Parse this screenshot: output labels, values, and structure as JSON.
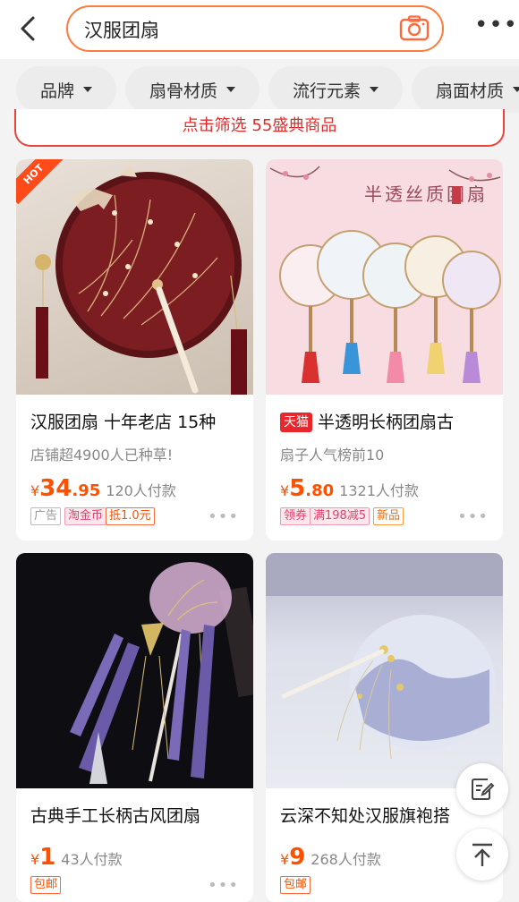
{
  "search": {
    "query": "汉服团扇"
  },
  "filters": [
    {
      "label": "品牌"
    },
    {
      "label": "扇骨材质"
    },
    {
      "label": "流行元素"
    },
    {
      "label": "扇面材质"
    }
  ],
  "banner": {
    "text": "点击筛选 55盛典商品"
  },
  "products": [
    {
      "badge": "HOT",
      "title": "汉服团扇 十年老店 15种",
      "subtitle": "店铺超4900人已种草!",
      "price_symbol": "¥",
      "price_int": "34",
      "price_dec": ".95",
      "sold": "120人付款",
      "tags": [
        "广告",
        "淘金币",
        "抵1.0元"
      ]
    },
    {
      "brand_tag": "天猫",
      "image_caption": "半透丝质团扇",
      "title": "半透明长柄团扇古",
      "subtitle": "扇子人气榜前10",
      "price_symbol": "¥",
      "price_int": "5",
      "price_dec": ".80",
      "sold": "1321人付款",
      "tags": [
        "领券",
        "满198减5",
        "新品"
      ]
    },
    {
      "title": "古典手工长柄古风团扇",
      "price_symbol": "¥",
      "price_int": "1",
      "price_dec": "",
      "sold": "43人付款",
      "tags": [
        "包邮"
      ]
    },
    {
      "title": "云深不知处汉服旗袍搭",
      "price_symbol": "¥",
      "price_int": "9",
      "price_dec": "",
      "sold": "268人付款",
      "tags": [
        "包邮"
      ]
    }
  ],
  "colors": {
    "accent": "#ff5000",
    "search_border": "#ff7a3d",
    "banner": "#e22a2a"
  }
}
